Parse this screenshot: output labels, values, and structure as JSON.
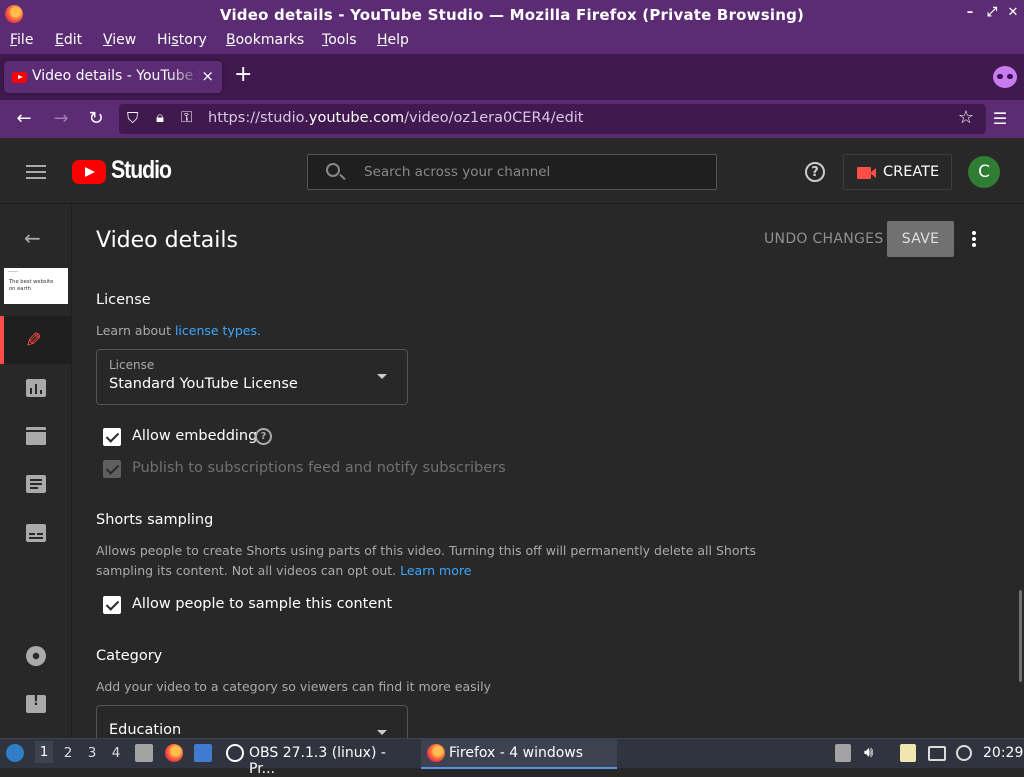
{
  "window": {
    "title": "Video details - YouTube Studio — Mozilla Firefox (Private Browsing)"
  },
  "menu": {
    "items": [
      {
        "label": "File",
        "u": "F",
        "rest": "ile"
      },
      {
        "label": "Edit",
        "u": "E",
        "rest": "dit"
      },
      {
        "label": "View",
        "u": "V",
        "rest": "iew"
      },
      {
        "label": "History",
        "pre": "Hi",
        "u": "s",
        "rest": "tory"
      },
      {
        "label": "Bookmarks",
        "u": "B",
        "rest": "ookmarks"
      },
      {
        "label": "Tools",
        "u": "T",
        "rest": "ools"
      },
      {
        "label": "Help",
        "u": "H",
        "rest": "elp"
      }
    ]
  },
  "tabs": {
    "active_label": "Video details - YouTube Studio",
    "close": "×",
    "new_tab": "+"
  },
  "navbar": {
    "url_prefix": "https://studio.",
    "url_domain": "youtube.com",
    "url_path": "/video/oz1era0CER4/edit"
  },
  "studio": {
    "logo_text": "Studio",
    "search_placeholder": "Search across your channel",
    "help": "?",
    "create_label": "CREATE",
    "avatar_letter": "C"
  },
  "rail": {
    "thumbnail_text": "The best website on earth"
  },
  "page": {
    "title": "Video details",
    "undo_label": "UNDO CHANGES",
    "save_label": "SAVE"
  },
  "license": {
    "heading": "License",
    "learn_prefix": "Learn about ",
    "learn_link": "license types.",
    "select_label": "License",
    "select_value": "Standard YouTube License",
    "allow_embedding": "Allow embedding",
    "allow_embedding_checked": true,
    "publish_feed": "Publish to subscriptions feed and notify subscribers",
    "publish_feed_checked": true,
    "publish_feed_disabled": true
  },
  "shorts": {
    "heading": "Shorts sampling",
    "desc_line1": "Allows people to create Shorts using parts of this video. Turning this off will permanently delete all Shorts",
    "desc_line2": "sampling its content. Not all videos can opt out. ",
    "learn_more": "Learn more",
    "allow_sample": "Allow people to sample this content",
    "allow_sample_checked": true
  },
  "category": {
    "heading": "Category",
    "desc": "Add your video to a category so viewers can find it more easily",
    "select_value": "Education"
  },
  "taskbar": {
    "workspaces": [
      "1",
      "2",
      "3",
      "4"
    ],
    "obs_label": "OBS 27.1.3 (linux) - Pr...",
    "firefox_label": "Firefox - 4 windows",
    "clock": "20:29"
  },
  "colors": {
    "firefox_purple": "#5b2b73",
    "studio_bg": "#282828",
    "accent_red": "#ff4e45",
    "link_blue": "#3ea6ff"
  }
}
